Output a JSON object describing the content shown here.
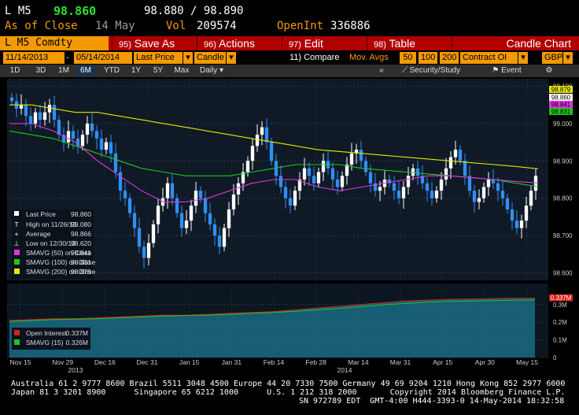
{
  "header": {
    "ticker": "L M5",
    "last": "98.860",
    "bid_ask": "98.880 / 98.890",
    "as_of_label": "As of Close",
    "as_of_date": "14 May",
    "vol_label": "Vol",
    "vol": "209574",
    "oi_label": "OpenInt",
    "oi": "336886"
  },
  "menubar": {
    "security": "L M5 Comdty",
    "save_num": "95)",
    "save": "Save As",
    "actions_num": "96)",
    "actions": "Actions",
    "edit_num": "97)",
    "edit": "Edit",
    "table_num": "98)",
    "table": "Table",
    "chart_name": "Candle Chart"
  },
  "controls": {
    "start_date": "11/14/2013",
    "dash": "-",
    "end_date": "05/14/2014",
    "price_field": "Last Price",
    "chart_style": "Candle",
    "compare": "11) Compare",
    "mov_avgs": "Mov. Avgs",
    "ma1": "50",
    "ma2": "100",
    "ma3": "200",
    "contract": "Contract OI",
    "currency": "GBP"
  },
  "tabs": {
    "items": [
      "1D",
      "3D",
      "1M",
      "6M",
      "YTD",
      "1Y",
      "5Y",
      "Max"
    ],
    "active": "6M",
    "frequency": "Daily",
    "nav_left": "«",
    "security_study": "Security/Study",
    "event": "Event",
    "settings": "⚙"
  },
  "colors": {
    "candle_up": "#ffffff",
    "candle_down": "#2f8ff5",
    "sma50": "#e033e0",
    "sma100": "#22c422",
    "sma200": "#e6e600",
    "oi_line": "#d42020",
    "oi_sma": "#22c422",
    "oi_fill": "#1a6a84",
    "accent_orange": "#f29a00",
    "menubar_red": "#b00000"
  },
  "legend": {
    "last_price_label": "Last Price",
    "last_price": "98.860",
    "high_label": "High on 11/26/13",
    "high": "99.080",
    "avg_label": "Average",
    "avg": "98.866",
    "low_label": "Low on 12/30/13",
    "low": "98.620",
    "sma50_label": "SMAVG (50) on Close",
    "sma50": "98.841",
    "sma100_label": "SMAVG (100) on Close",
    "sma100": "98.831",
    "sma200_label": "SMAVG (200) on Close",
    "sma200": "98.879",
    "oi_label": "Open Interest",
    "oi": "0.337M",
    "oi_sma_label": "SMAVG (15)",
    "oi_sma": "0.326M"
  },
  "chart_data": {
    "type": "candlestick",
    "ylim": [
      98.58,
      99.12
    ],
    "y_ticks": [
      "99.100",
      "99.000",
      "98.900",
      "98.800",
      "98.700",
      "98.600"
    ],
    "price_tags": [
      "98.879",
      "98.860",
      "98.841",
      "98.831"
    ],
    "x_tick_labels": [
      "Nov 15",
      "Nov 29",
      "Dec 16",
      "Dec 31",
      "Jan 15",
      "Jan 31",
      "Feb 14",
      "Feb 28",
      "Mar 14",
      "Mar 31",
      "Apr 15",
      "Apr 30",
      "May 15"
    ],
    "year_labels": [
      "2013",
      "2014"
    ],
    "closes": [
      99.06,
      99.04,
      99.05,
      99.02,
      99.0,
      99.03,
      99.01,
      99.03,
      99.05,
      99.01,
      98.97,
      98.95,
      98.98,
      98.96,
      98.94,
      98.97,
      99.0,
      98.98,
      98.96,
      98.93,
      98.95,
      98.92,
      98.87,
      98.82,
      98.8,
      98.76,
      98.72,
      98.67,
      98.64,
      98.68,
      98.73,
      98.78,
      98.8,
      98.84,
      98.8,
      98.76,
      98.72,
      98.74,
      98.78,
      98.82,
      98.8,
      98.76,
      98.73,
      98.7,
      98.67,
      98.72,
      98.77,
      98.81,
      98.84,
      98.87,
      98.9,
      98.94,
      98.97,
      98.99,
      98.95,
      98.9,
      98.86,
      98.83,
      98.8,
      98.78,
      98.82,
      98.85,
      98.88,
      98.86,
      98.84,
      98.87,
      98.9,
      98.88,
      98.85,
      98.83,
      98.86,
      98.89,
      98.92,
      98.93,
      98.9,
      98.87,
      98.84,
      98.82,
      98.83,
      98.85,
      98.84,
      98.82,
      98.8,
      98.83,
      98.86,
      98.88,
      98.86,
      98.84,
      98.82,
      98.8,
      98.82,
      98.85,
      98.88,
      98.91,
      98.93,
      98.9,
      98.86,
      98.82,
      98.79,
      98.8,
      98.83,
      98.85,
      98.84,
      98.82,
      98.8,
      98.77,
      98.74,
      98.72,
      98.74,
      98.78,
      98.82,
      98.86
    ],
    "sma200": [
      99.05,
      99.05,
      99.04,
      99.03,
      99.03,
      99.02,
      99.01,
      99.0,
      98.99,
      98.98,
      98.97,
      98.96,
      98.95,
      98.94,
      98.93,
      98.925,
      98.92,
      98.915,
      98.91,
      98.905,
      98.9,
      98.895,
      98.89,
      98.885,
      98.879
    ],
    "sma100": [
      98.98,
      98.97,
      98.96,
      98.94,
      98.92,
      98.9,
      98.88,
      98.87,
      98.86,
      98.86,
      98.86,
      98.87,
      98.88,
      98.89,
      98.89,
      98.89,
      98.88,
      98.875,
      98.87,
      98.865,
      98.86,
      98.855,
      98.85,
      98.84,
      98.831
    ],
    "sma50": [
      99.0,
      99.0,
      98.98,
      98.95,
      98.9,
      98.86,
      98.82,
      98.79,
      98.79,
      98.8,
      98.82,
      98.84,
      98.85,
      98.85,
      98.83,
      98.82,
      98.83,
      98.84,
      98.85,
      98.86,
      98.86,
      98.855,
      98.85,
      98.845,
      98.841
    ],
    "oi_ticks": [
      "0.337M",
      "0.3M",
      "0.2M",
      "0.1M",
      "0"
    ],
    "oi_ylim": [
      0,
      0.42
    ],
    "oi": [
      0.21,
      0.215,
      0.22,
      0.22,
      0.225,
      0.23,
      0.235,
      0.24,
      0.24,
      0.245,
      0.25,
      0.255,
      0.26,
      0.27,
      0.28,
      0.29,
      0.3,
      0.31,
      0.32,
      0.325,
      0.33,
      0.332,
      0.334,
      0.336,
      0.337
    ],
    "oi_sma15": [
      0.205,
      0.21,
      0.215,
      0.218,
      0.22,
      0.225,
      0.23,
      0.235,
      0.238,
      0.24,
      0.245,
      0.25,
      0.255,
      0.262,
      0.27,
      0.278,
      0.288,
      0.298,
      0.306,
      0.313,
      0.318,
      0.321,
      0.323,
      0.325,
      0.326
    ]
  },
  "footer": {
    "line1": "Australia 61 2 9777 8600 Brazil 5511 3048 4500 Europe 44 20 7330 7500 Germany 49 69 9204 1210 Hong Kong 852 2977 6000",
    "line2": "Japan 81 3 3201 8900      Singapore 65 6212 1000      U.S. 1 212 318 2000       Copyright 2014 Bloomberg Finance L.P.",
    "line3": "SN 972789 EDT  GMT-4:00 H444-3393-0 14-May-2014 18:32:58"
  }
}
